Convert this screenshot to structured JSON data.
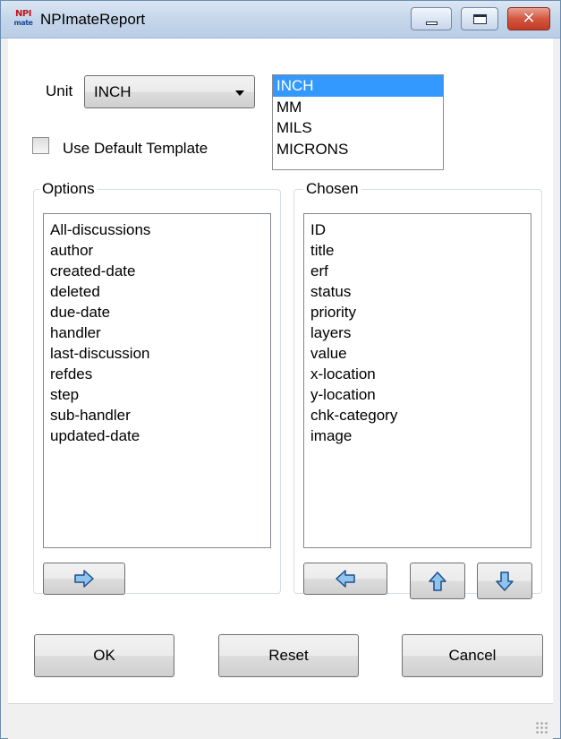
{
  "window": {
    "title": "NPImateReport",
    "icon_text_top": "NPI",
    "icon_text_bottom": "mate",
    "buttons": [
      "minimize-icon",
      "maximize-icon",
      "close-icon"
    ]
  },
  "unit": {
    "label": "Unit",
    "selected": "INCH",
    "options": [
      "INCH",
      "MM",
      "MILS",
      "MICRONS"
    ],
    "highlighted": "INCH"
  },
  "template": {
    "label": "Use Default Template",
    "checked": false
  },
  "options_group": {
    "title": "Options",
    "items": [
      "All-discussions",
      "author",
      "created-date",
      "deleted",
      "due-date",
      "handler",
      "last-discussion",
      "refdes",
      "step",
      "sub-handler",
      "updated-date"
    ]
  },
  "chosen_group": {
    "title": "Chosen",
    "items": [
      "ID",
      "title",
      "erf",
      "status",
      "priority",
      "layers",
      "value",
      "x-location",
      "y-location",
      "chk-category",
      "image"
    ]
  },
  "actions": {
    "ok": "OK",
    "reset": "Reset",
    "cancel": "Cancel"
  },
  "colors": {
    "selection": "#3399ff",
    "arrow_fill": "#8fc4ee",
    "arrow_stroke": "#1f4f8a"
  }
}
